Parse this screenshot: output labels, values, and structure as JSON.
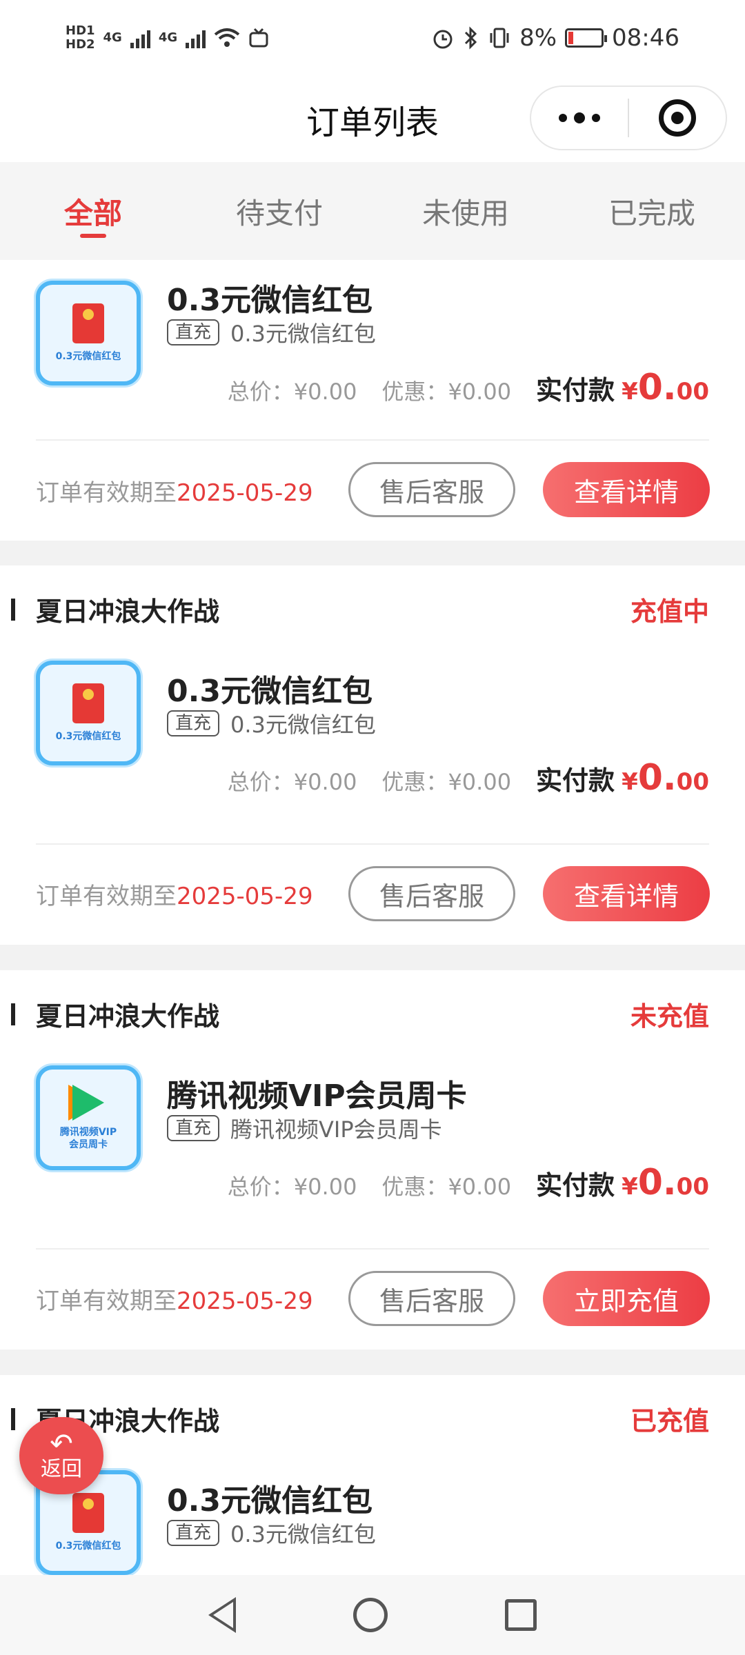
{
  "status_bar": {
    "hd1": "HD1",
    "hd2": "HD2",
    "net1": "4G",
    "net2": "4G",
    "battery_pct": "8%",
    "time": "08:46"
  },
  "nav": {
    "title": "订单列表"
  },
  "tabs": [
    {
      "label": "全部",
      "active": true
    },
    {
      "label": "待支付",
      "active": false
    },
    {
      "label": "未使用",
      "active": false
    },
    {
      "label": "已完成",
      "active": false
    }
  ],
  "labels": {
    "tag": "直充",
    "total_prefix": "总价：",
    "discount_prefix": "优惠：",
    "paid_label": "实付款",
    "currency": "¥",
    "validity_prefix": "订单有效期至",
    "after_sale": "售后客服",
    "back": "返回"
  },
  "orders": [
    {
      "shop": "",
      "status": "",
      "product_name": "0.3元微信红包",
      "thumb_label": "0.3元微信红包",
      "thumb_icon": "red-packet-icon",
      "tag_text": "0.3元微信红包",
      "total": "¥0.00",
      "discount": "¥0.00",
      "paid_int": "0.",
      "paid_dec": "00",
      "valid_date": "2025-05-29",
      "action": "查看详情"
    },
    {
      "shop": "夏日冲浪大作战",
      "status": "充值中",
      "product_name": "0.3元微信红包",
      "thumb_label": "0.3元微信红包",
      "thumb_icon": "red-packet-icon",
      "tag_text": "0.3元微信红包",
      "total": "¥0.00",
      "discount": "¥0.00",
      "paid_int": "0.",
      "paid_dec": "00",
      "valid_date": "2025-05-29",
      "action": "查看详情"
    },
    {
      "shop": "夏日冲浪大作战",
      "status": "未充值",
      "product_name": "腾讯视频VIP会员周卡",
      "thumb_label_1": "腾讯视频VIP",
      "thumb_label_2": "会员周卡",
      "thumb_icon": "tencent-video-icon",
      "tag_text": "腾讯视频VIP会员周卡",
      "total": "¥0.00",
      "discount": "¥0.00",
      "paid_int": "0.",
      "paid_dec": "00",
      "valid_date": "2025-05-29",
      "action": "立即充值"
    },
    {
      "shop": "夏日冲浪大作战",
      "status": "已充值",
      "product_name": "0.3元微信红包",
      "thumb_label": "0.3元微信红包",
      "thumb_icon": "red-packet-icon",
      "tag_text": "0.3元微信红包"
    }
  ],
  "colors": {
    "accent": "#e53b3b",
    "button_gradient_start": "#f66f6f",
    "button_gradient_end": "#ec3d44"
  }
}
